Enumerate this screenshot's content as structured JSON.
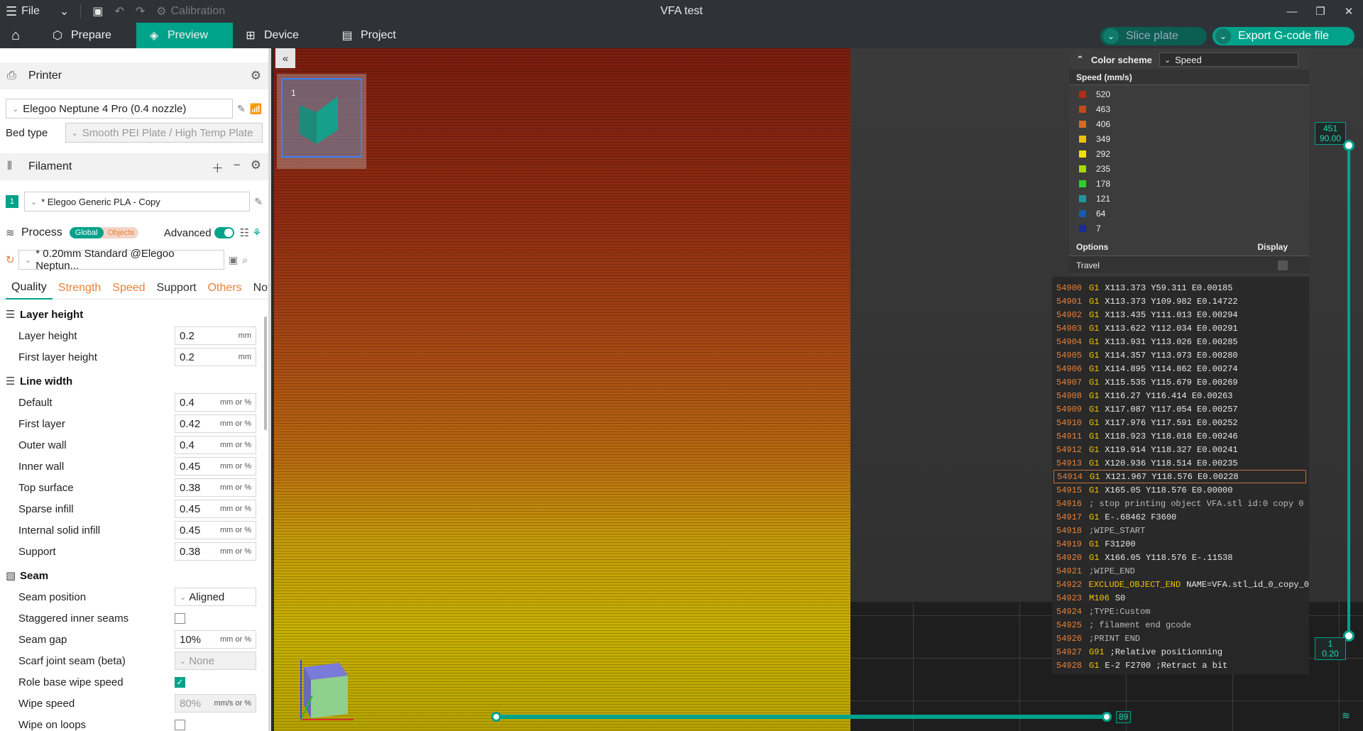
{
  "titlebar": {
    "file_label": "File",
    "calibration_label": "Calibration",
    "window_title": "VFA test"
  },
  "tabs": [
    {
      "label": "Prepare"
    },
    {
      "label": "Preview"
    },
    {
      "label": "Device"
    },
    {
      "label": "Project"
    }
  ],
  "actions": {
    "slice_label": "Slice plate",
    "export_label": "Export G-code file"
  },
  "printer": {
    "section_label": "Printer",
    "name": "Elegoo Neptune 4 Pro (0.4 nozzle)",
    "bed_type_label": "Bed type",
    "bed_type_value": "Smooth PEI Plate / High Temp Plate"
  },
  "filament": {
    "section_label": "Filament",
    "slot": "1",
    "name": "* Elegoo Generic PLA - Copy"
  },
  "process": {
    "section_label": "Process",
    "global_label": "Global",
    "objects_label": "Objects",
    "advanced_label": "Advanced",
    "preset": "* 0.20mm Standard @Elegoo Neptun..."
  },
  "quality_tabs": [
    {
      "label": "Quality"
    },
    {
      "label": "Strength"
    },
    {
      "label": "Speed"
    },
    {
      "label": "Support"
    },
    {
      "label": "Others"
    },
    {
      "label": "Notes"
    }
  ],
  "groups": {
    "layer_height": {
      "title": "Layer height",
      "rows": [
        {
          "label": "Layer height",
          "value": "0.2",
          "unit": "mm"
        },
        {
          "label": "First layer height",
          "value": "0.2",
          "unit": "mm"
        }
      ]
    },
    "line_width": {
      "title": "Line width",
      "rows": [
        {
          "label": "Default",
          "value": "0.4",
          "unit": "mm or %"
        },
        {
          "label": "First layer",
          "value": "0.42",
          "unit": "mm or %"
        },
        {
          "label": "Outer wall",
          "value": "0.4",
          "unit": "mm or %"
        },
        {
          "label": "Inner wall",
          "value": "0.45",
          "unit": "mm or %"
        },
        {
          "label": "Top surface",
          "value": "0.38",
          "unit": "mm or %"
        },
        {
          "label": "Sparse infill",
          "value": "0.45",
          "unit": "mm or %"
        },
        {
          "label": "Internal solid infill",
          "value": "0.45",
          "unit": "mm or %"
        },
        {
          "label": "Support",
          "value": "0.38",
          "unit": "mm or %"
        }
      ]
    },
    "seam": {
      "title": "Seam",
      "seam_position_label": "Seam position",
      "seam_position_value": "Aligned",
      "staggered_label": "Staggered inner seams",
      "seam_gap_label": "Seam gap",
      "seam_gap_value": "10%",
      "seam_gap_unit": "mm or %",
      "scarf_label": "Scarf joint seam (beta)",
      "scarf_value": "None",
      "role_wipe_label": "Role base wipe speed",
      "wipe_speed_label": "Wipe speed",
      "wipe_speed_value": "80%",
      "wipe_speed_unit": "mm/s or %",
      "wipe_loops_label": "Wipe on loops"
    }
  },
  "viewport": {
    "plate_number": "1",
    "vertical_top_layer": "451",
    "vertical_top_height": "90.00",
    "vertical_bottom_layer": "1",
    "vertical_bottom_height": "0.20",
    "horizontal_value": "89"
  },
  "legend": {
    "color_scheme_label": "Color scheme",
    "color_scheme_value": "Speed",
    "caption": "Speed (mm/s)",
    "items": [
      {
        "value": "520",
        "color": "#b52a1c"
      },
      {
        "value": "463",
        "color": "#c8461e"
      },
      {
        "value": "406",
        "color": "#d86a1e"
      },
      {
        "value": "349",
        "color": "#e8c200"
      },
      {
        "value": "292",
        "color": "#f0e000"
      },
      {
        "value": "235",
        "color": "#a8d800"
      },
      {
        "value": "178",
        "color": "#2ed02a"
      },
      {
        "value": "121",
        "color": "#1a9a9a"
      },
      {
        "value": "64",
        "color": "#1a5aa8"
      },
      {
        "value": "7",
        "color": "#1a2a9a"
      }
    ],
    "options_label": "Options",
    "display_label": "Display",
    "travel_label": "Travel"
  },
  "gcode": [
    {
      "n": "54900",
      "cmd": "G1",
      "args": "X113.373 Y59.311 E0.00185"
    },
    {
      "n": "54901",
      "cmd": "G1",
      "args": "X113.373 Y109.982 E0.14722"
    },
    {
      "n": "54902",
      "cmd": "G1",
      "args": "X113.435 Y111.013 E0.00294"
    },
    {
      "n": "54903",
      "cmd": "G1",
      "args": "X113.622 Y112.034 E0.00291"
    },
    {
      "n": "54904",
      "cmd": "G1",
      "args": "X113.931 Y113.026 E0.00285"
    },
    {
      "n": "54905",
      "cmd": "G1",
      "args": "X114.357 Y113.973 E0.00280"
    },
    {
      "n": "54906",
      "cmd": "G1",
      "args": "X114.895 Y114.862 E0.00274"
    },
    {
      "n": "54907",
      "cmd": "G1",
      "args": "X115.535 Y115.679 E0.00269"
    },
    {
      "n": "54908",
      "cmd": "G1",
      "args": "X116.27 Y116.414 E0.00263"
    },
    {
      "n": "54909",
      "cmd": "G1",
      "args": "X117.087 Y117.054 E0.00257"
    },
    {
      "n": "54910",
      "cmd": "G1",
      "args": "X117.976 Y117.591 E0.00252"
    },
    {
      "n": "54911",
      "cmd": "G1",
      "args": "X118.923 Y118.018 E0.00246"
    },
    {
      "n": "54912",
      "cmd": "G1",
      "args": "X119.914 Y118.327 E0.00241"
    },
    {
      "n": "54913",
      "cmd": "G1",
      "args": "X120.936 Y118.514 E0.00235"
    },
    {
      "n": "54914",
      "cmd": "G1",
      "args": "X121.967 Y118.576 E0.00228"
    },
    {
      "n": "54915",
      "cmd": "G1",
      "args": "X165.05 Y118.576 E0.00000"
    },
    {
      "n": "54916",
      "cmd": "",
      "args": "; stop printing object VFA.stl id:0 copy 0"
    },
    {
      "n": "54917",
      "cmd": "G1",
      "args": "E-.68462 F3600"
    },
    {
      "n": "54918",
      "cmd": "",
      "args": ";WIPE_START"
    },
    {
      "n": "54919",
      "cmd": "G1",
      "args": "F31200"
    },
    {
      "n": "54920",
      "cmd": "G1",
      "args": "X166.05 Y118.576 E-.11538"
    },
    {
      "n": "54921",
      "cmd": "",
      "args": ";WIPE_END"
    },
    {
      "n": "54922",
      "cmd": "EXCLUDE_OBJECT_END",
      "args": "NAME=VFA.stl_id_0_copy_0"
    },
    {
      "n": "54923",
      "cmd": "M106",
      "args": "S0"
    },
    {
      "n": "54924",
      "cmd": "",
      "args": ";TYPE:Custom"
    },
    {
      "n": "54925",
      "cmd": "",
      "args": "; filament end gcode"
    },
    {
      "n": "54926",
      "cmd": "",
      "args": ";PRINT END"
    },
    {
      "n": "54927",
      "cmd": "G91",
      "args": ";Relative positionning"
    },
    {
      "n": "54928",
      "cmd": "G1",
      "args": "E-2 F2700 ;Retract a bit"
    }
  ]
}
